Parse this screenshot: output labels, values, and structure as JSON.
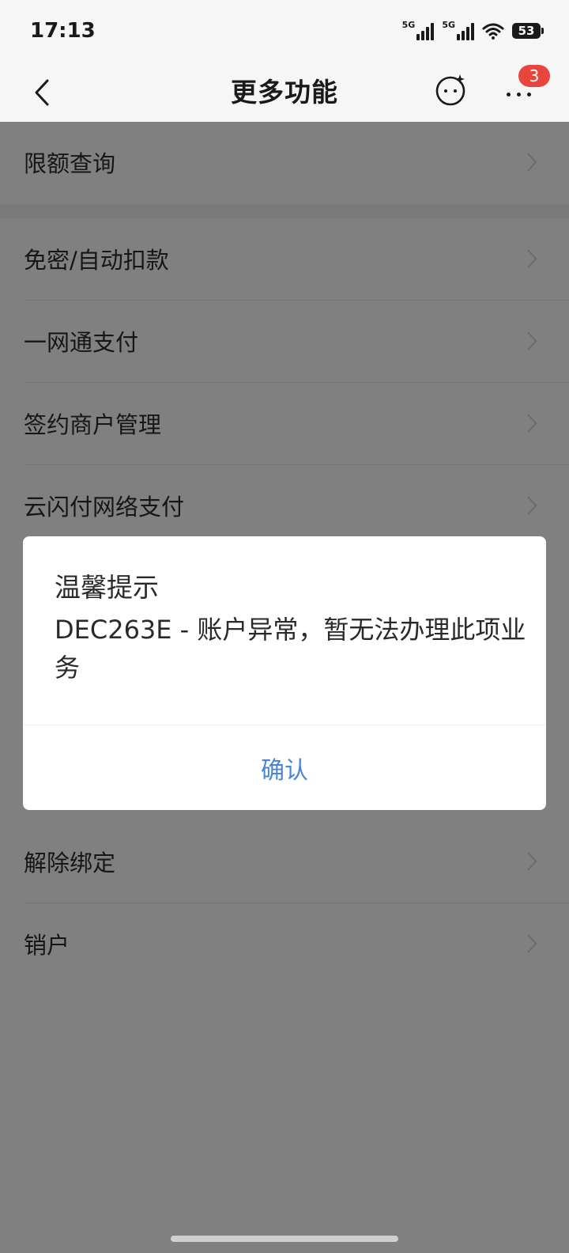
{
  "status_bar": {
    "time": "17:13",
    "network_1": "5G",
    "network_2": "5G",
    "battery": "53"
  },
  "header": {
    "title": "更多功能",
    "badge_count": "3"
  },
  "list": {
    "items": [
      {
        "label": "限额查询"
      },
      {
        "label": "免密/自动扣款"
      },
      {
        "label": "一网通支付"
      },
      {
        "label": "签约商户管理"
      },
      {
        "label": "云闪付网络支付"
      },
      {
        "label": "解除绑定"
      },
      {
        "label": "销户"
      }
    ]
  },
  "dialog": {
    "title": "温馨提示",
    "message": "DEC263E - 账户异常，暂无法办理此项业务",
    "confirm_label": "确认"
  },
  "colors": {
    "overlay": "#808080",
    "accent": "#4a84d4",
    "badge": "#e8453c"
  },
  "icons": {
    "back": "chevron-left-icon",
    "assistant": "assistant-face-icon",
    "more": "more-dots-icon",
    "row": "chevron-right-icon"
  }
}
